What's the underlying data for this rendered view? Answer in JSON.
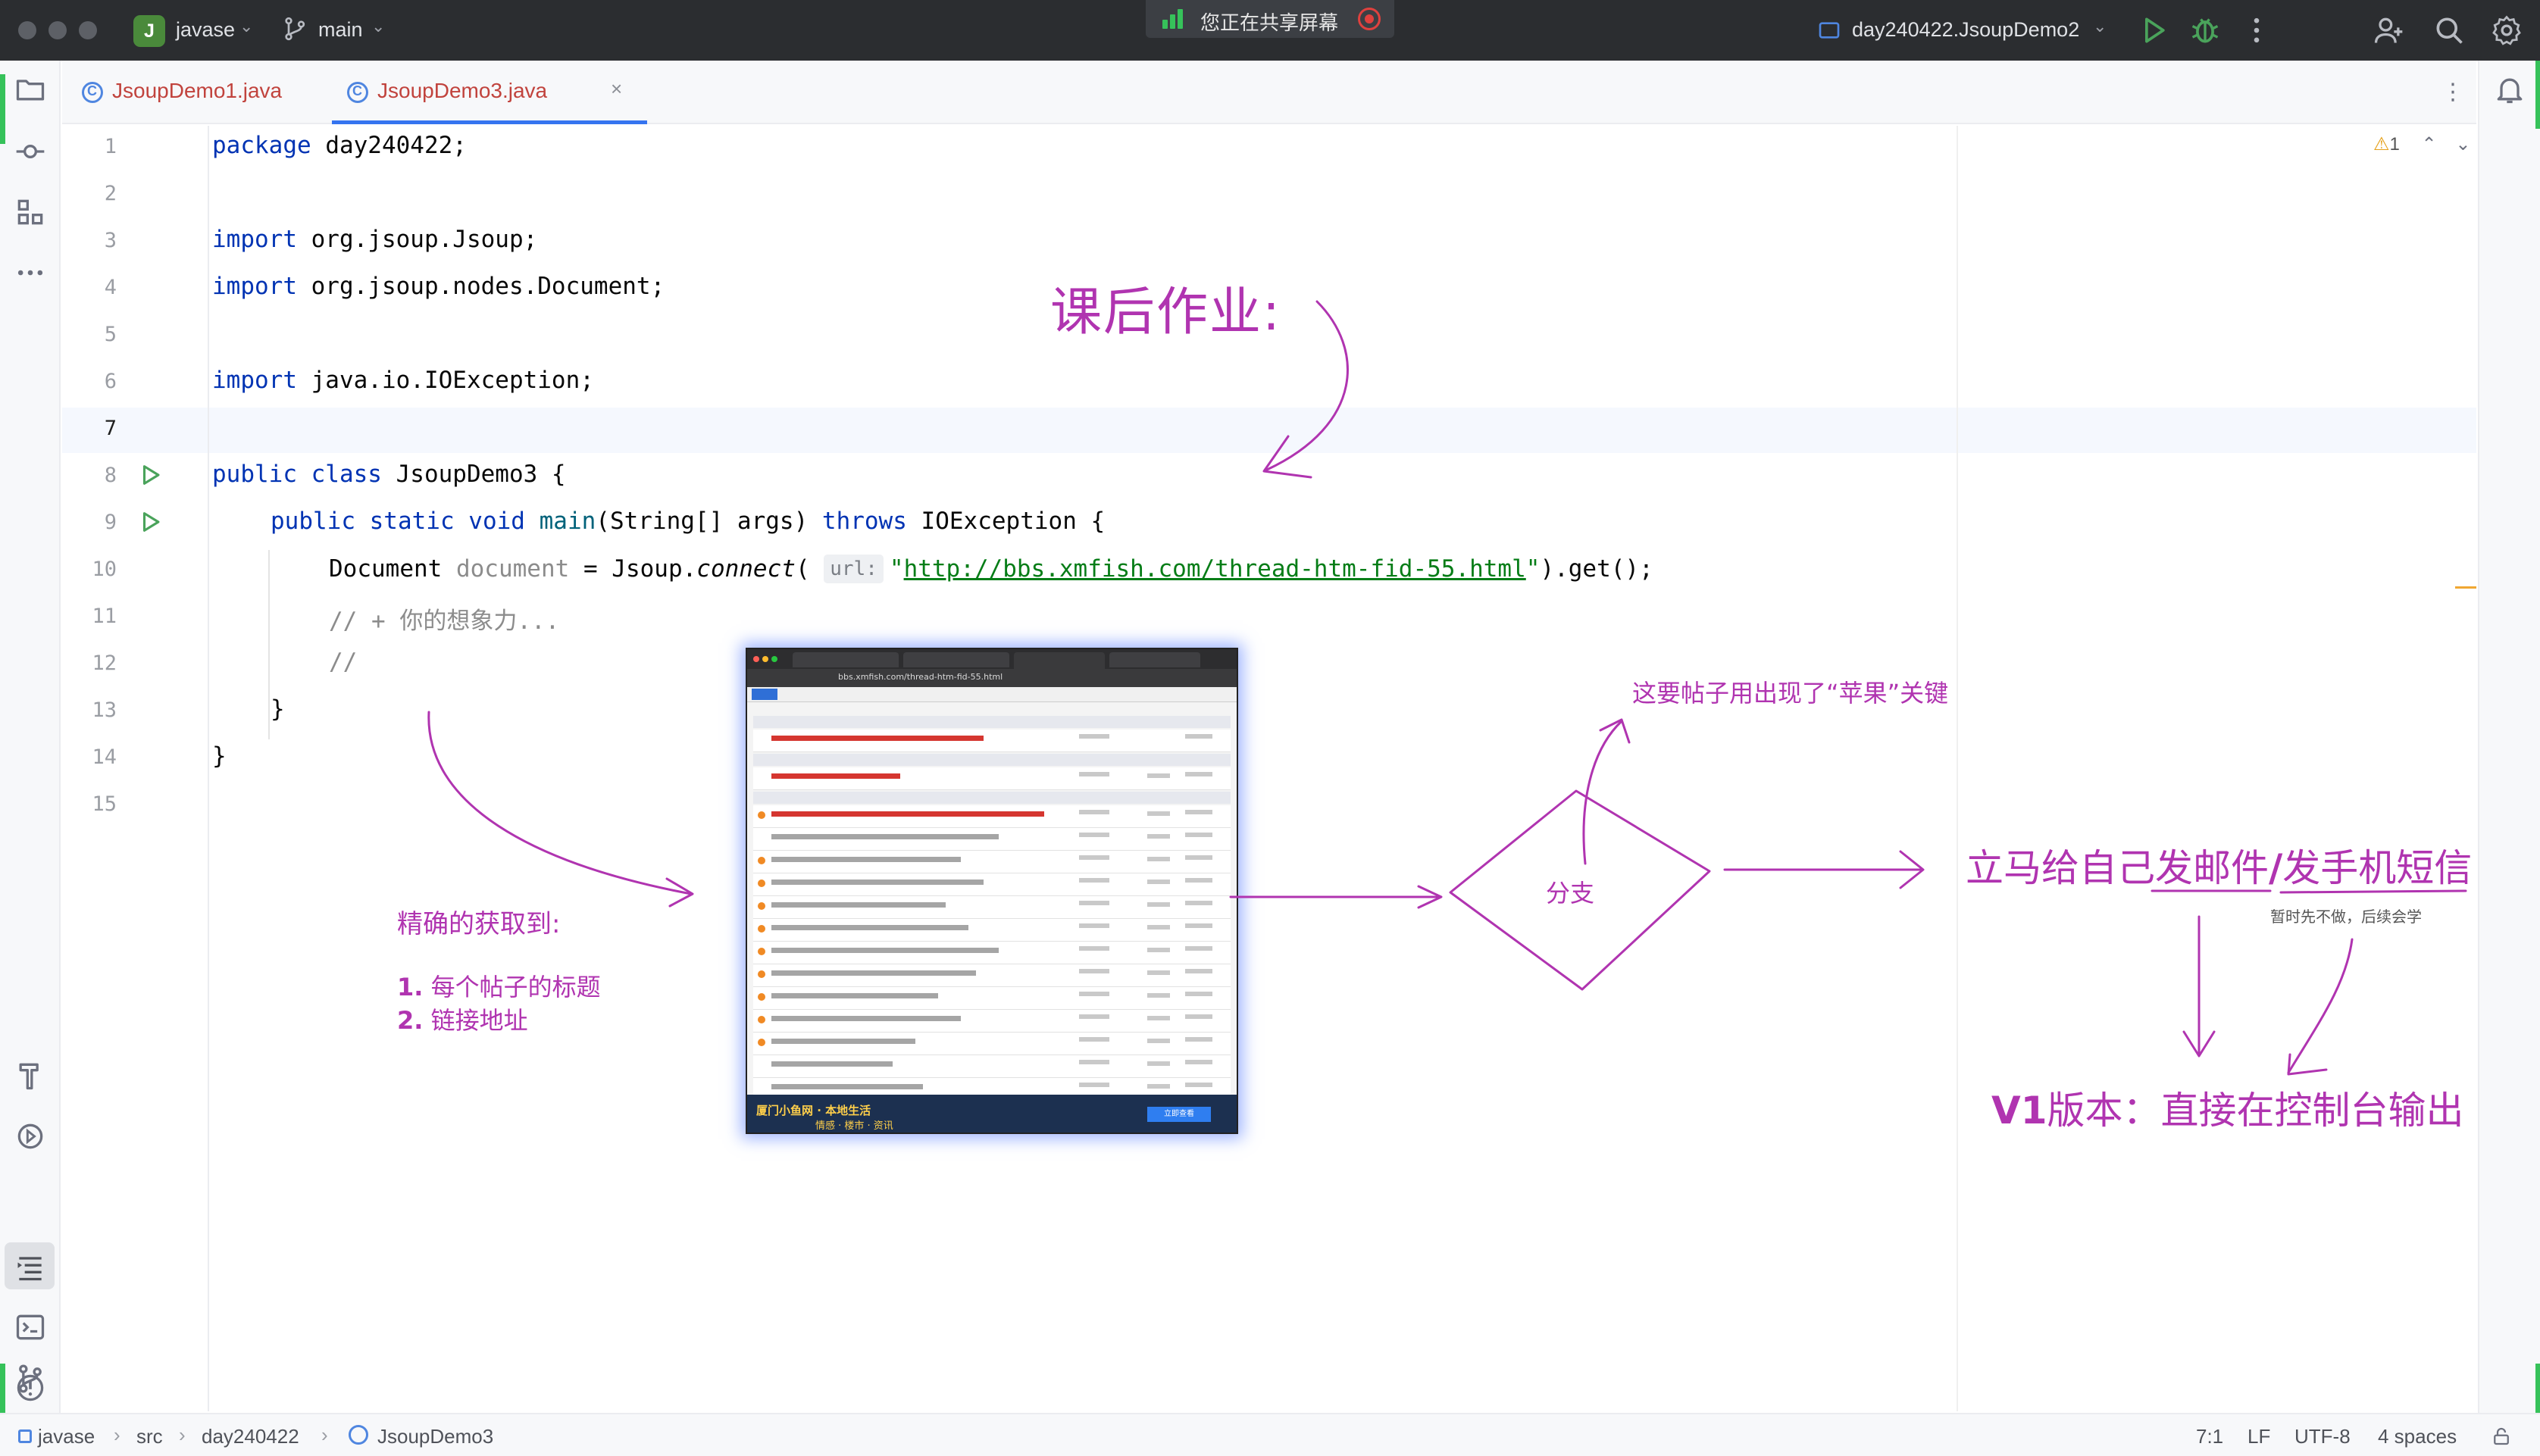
{
  "titlebar": {
    "project_badge": "J",
    "project_name": "javase",
    "branch": "main",
    "sharing_text": "您正在共享屏幕",
    "run_config": "day240422.JsoupDemo2"
  },
  "tabs": [
    {
      "label": "JsoupDemo1.java",
      "active": false
    },
    {
      "label": "JsoupDemo3.java",
      "active": true
    }
  ],
  "editor": {
    "line_numbers": [
      "1",
      "2",
      "3",
      "4",
      "5",
      "6",
      "7",
      "8",
      "9",
      "10",
      "11",
      "12",
      "13",
      "14",
      "15"
    ],
    "warning_count": "1",
    "lines": {
      "l1": {
        "kw": "package",
        "rest": " day240422;"
      },
      "l3": {
        "kw": "import",
        "rest": " org.jsoup.Jsoup;"
      },
      "l4": {
        "kw": "import",
        "rest": " org.jsoup.nodes.Document;"
      },
      "l6": {
        "kw": "import",
        "rest": " java.io.IOException;"
      },
      "l8": {
        "kw": "public class",
        "rest": " JsoupDemo3 {"
      },
      "l9": {
        "kw1": "public static void",
        "fn": "main",
        "args": "(String[] args) ",
        "kw2": "throws",
        "rest": " IOException {"
      },
      "l10": {
        "type": "Document ",
        "var": "document",
        "mid": " = Jsoup.",
        "call": "connect",
        "open": "( ",
        "hint": "url:",
        "q1": "\"",
        "url": "http://bbs.xmfish.com/thread-htm-fid-55.html",
        "q2": "\"",
        "tail": ").get();"
      },
      "l11": "// + 你的想象力...",
      "l12": "//",
      "l13": "}",
      "l14": "}"
    }
  },
  "annotations": {
    "homework": "课后作业:",
    "precise": "精确的获取到:",
    "item1_num": "1.",
    "item1": "每个帖子的标题",
    "item2_num": "2.",
    "item2": "链接地址",
    "branch": "分支",
    "apple": "这要帖子用出现了“苹果”关键",
    "notify_a": "立马给自己",
    "notify_b": "发邮件",
    "notify_sep": "/",
    "notify_c": "发手机短信",
    "later": "暂时先不做，后续会学",
    "v1_bold": "V1",
    "v1": "版本：直接在控制台输出"
  },
  "embedded_screenshot": {
    "url": "bbs.xmfish.com/thread-htm-fid-55.html",
    "banner_line1": "厦门小鱼网 · 本地生活",
    "banner_line2": "情感 · 楼市 · 资讯",
    "banner_button": "立即查看"
  },
  "statusbar": {
    "crumbs": [
      "javase",
      "src",
      "day240422",
      "JsoupDemo3"
    ],
    "position": "7:1",
    "line_sep": "LF",
    "encoding": "UTF-8",
    "indent": "4 spaces"
  },
  "colors": {
    "keyword": "#0033b3",
    "string": "#067d17",
    "annotation": "#b034b0",
    "accent": "#3574f0"
  }
}
